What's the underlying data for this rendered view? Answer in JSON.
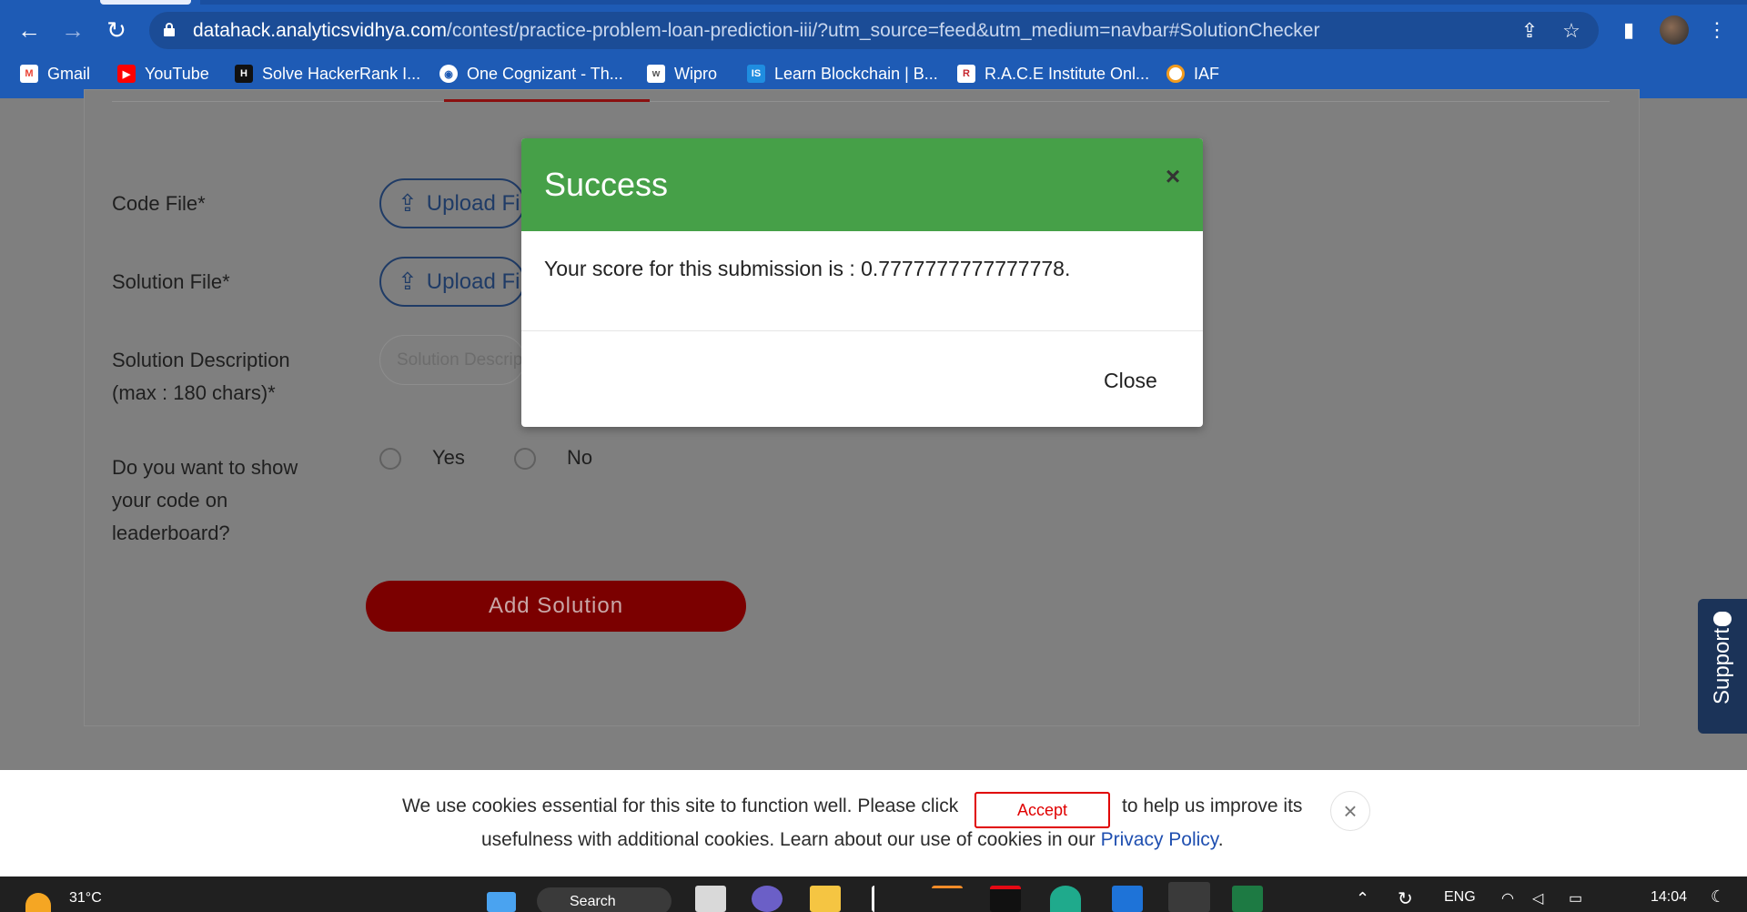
{
  "browser": {
    "url_host": "datahack.analyticsvidhya.com",
    "url_path": "/contest/practice-problem-loan-prediction-iii/?utm_source=feed&utm_medium=navbar#SolutionChecker",
    "nav": {
      "back": "←",
      "forward": "→",
      "reload": "↻"
    },
    "icons": {
      "share": "⇪",
      "star": "☆",
      "sidebar": "▮",
      "menu": "⋮"
    }
  },
  "bookmarks": [
    {
      "label": "Gmail",
      "icon": "gmail-icon",
      "color": "#ea4335"
    },
    {
      "label": "YouTube",
      "icon": "youtube-icon",
      "color": "#ff0000"
    },
    {
      "label": "Solve HackerRank I...",
      "icon": "hackerrank-icon",
      "color": "#111111"
    },
    {
      "label": "One Cognizant - Th...",
      "icon": "globe-icon",
      "color": "#ffffff"
    },
    {
      "label": "Wipro",
      "icon": "wipro-icon",
      "color": "#ffffff"
    },
    {
      "label": "Learn Blockchain | B...",
      "icon": "is-icon",
      "color": "#1f8de0"
    },
    {
      "label": "R.A.C.E Institute Onl...",
      "icon": "race-icon",
      "color": "#c6262e"
    },
    {
      "label": "IAF",
      "icon": "iaf-icon",
      "color": "#f29b1d"
    }
  ],
  "form": {
    "code_file_label": "Code File*",
    "solution_file_label": "Solution File*",
    "upload_label": "Upload File",
    "description_label_line1": "Solution Description",
    "description_label_line2": "(max : 180 chars)*",
    "description_placeholder": "Solution Description",
    "show_code_line1": "Do you want to show",
    "show_code_line2": "your code on",
    "show_code_line3": "leaderboard?",
    "yes_label": "Yes",
    "no_label": "No",
    "submit_label": "Add Solution"
  },
  "support": {
    "label": "Support"
  },
  "modal": {
    "title": "Success",
    "close_x": "×",
    "message": "Your score for this submission is : 0.7777777777777778.",
    "close_label": "Close"
  },
  "cookie": {
    "text_before": "We use cookies essential for this site to function well. Please click",
    "accept_label": "Accept",
    "text_after": "to help us improve its",
    "line2_before": "usefulness with additional cookies. Learn about our use of cookies in our",
    "link_label": "Privacy Policy",
    "line2_end": ".",
    "close_x": "×"
  },
  "taskbar": {
    "weather": "31°C",
    "search_label": "Search",
    "language": "ENG",
    "time": "14:04"
  }
}
